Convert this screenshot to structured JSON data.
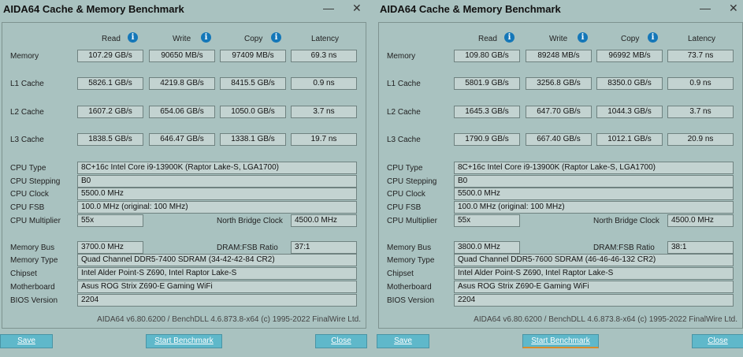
{
  "windows": [
    {
      "title": "AIDA64 Cache & Memory Benchmark",
      "minimize_glyph": "—",
      "close_glyph": "✕",
      "headers": {
        "read": "Read",
        "write": "Write",
        "copy": "Copy",
        "latency": "Latency",
        "info_glyph": "i"
      },
      "rows": [
        {
          "label": "Memory",
          "read": "107.29 GB/s",
          "write": "90650 MB/s",
          "copy": "97409 MB/s",
          "latency": "69.3 ns"
        },
        {
          "label": "L1 Cache",
          "read": "5826.1 GB/s",
          "write": "4219.8 GB/s",
          "copy": "8415.5 GB/s",
          "latency": "0.9 ns"
        },
        {
          "label": "L2 Cache",
          "read": "1607.2 GB/s",
          "write": "654.06 GB/s",
          "copy": "1050.0 GB/s",
          "latency": "3.7 ns"
        },
        {
          "label": "L3 Cache",
          "read": "1838.5 GB/s",
          "write": "646.47 GB/s",
          "copy": "1338.1 GB/s",
          "latency": "19.7 ns"
        }
      ],
      "cpu": {
        "type_label": "CPU Type",
        "type": "8C+16c Intel Core i9-13900K  (Raptor Lake-S, LGA1700)",
        "stepping_label": "CPU Stepping",
        "stepping": "B0",
        "clock_label": "CPU Clock",
        "clock": "5500.0 MHz",
        "fsb_label": "CPU FSB",
        "fsb": "100.0 MHz  (original: 100 MHz)",
        "mult_label": "CPU Multiplier",
        "mult": "55x",
        "nb_label": "North Bridge Clock",
        "nb": "4500.0 MHz"
      },
      "mem": {
        "bus_label": "Memory Bus",
        "bus": "3700.0 MHz",
        "ratio_label": "DRAM:FSB Ratio",
        "ratio": "37:1",
        "type_label": "Memory Type",
        "type": "Quad Channel DDR5-7400 SDRAM  (34-42-42-84 CR2)",
        "chipset_label": "Chipset",
        "chipset": "Intel Alder Point-S Z690, Intel Raptor Lake-S",
        "mobo_label": "Motherboard",
        "mobo": "Asus ROG Strix Z690-E Gaming WiFi",
        "bios_label": "BIOS Version",
        "bios": "2204"
      },
      "footer": "AIDA64 v6.80.6200 / BenchDLL 4.6.873.8-x64  (c) 1995-2022 FinalWire Ltd.",
      "buttons": {
        "save": "Save",
        "start": "Start Benchmark",
        "close": "Close"
      }
    },
    {
      "title": "AIDA64 Cache & Memory Benchmark",
      "minimize_glyph": "—",
      "close_glyph": "✕",
      "headers": {
        "read": "Read",
        "write": "Write",
        "copy": "Copy",
        "latency": "Latency",
        "info_glyph": "i"
      },
      "rows": [
        {
          "label": "Memory",
          "read": "109.80 GB/s",
          "write": "89248 MB/s",
          "copy": "96992 MB/s",
          "latency": "73.7 ns"
        },
        {
          "label": "L1 Cache",
          "read": "5801.9 GB/s",
          "write": "3256.8 GB/s",
          "copy": "8350.0 GB/s",
          "latency": "0.9 ns"
        },
        {
          "label": "L2 Cache",
          "read": "1645.3 GB/s",
          "write": "647.70 GB/s",
          "copy": "1044.3 GB/s",
          "latency": "3.7 ns"
        },
        {
          "label": "L3 Cache",
          "read": "1790.9 GB/s",
          "write": "667.40 GB/s",
          "copy": "1012.1 GB/s",
          "latency": "20.9 ns"
        }
      ],
      "cpu": {
        "type_label": "CPU Type",
        "type": "8C+16c Intel Core i9-13900K  (Raptor Lake-S, LGA1700)",
        "stepping_label": "CPU Stepping",
        "stepping": "B0",
        "clock_label": "CPU Clock",
        "clock": "5500.0 MHz",
        "fsb_label": "CPU FSB",
        "fsb": "100.0 MHz  (original: 100 MHz)",
        "mult_label": "CPU Multiplier",
        "mult": "55x",
        "nb_label": "North Bridge Clock",
        "nb": "4500.0 MHz"
      },
      "mem": {
        "bus_label": "Memory Bus",
        "bus": "3800.0 MHz",
        "ratio_label": "DRAM:FSB Ratio",
        "ratio": "38:1",
        "type_label": "Memory Type",
        "type": "Quad Channel DDR5-7600 SDRAM  (46-46-46-132 CR2)",
        "chipset_label": "Chipset",
        "chipset": "Intel Alder Point-S Z690, Intel Raptor Lake-S",
        "mobo_label": "Motherboard",
        "mobo": "Asus ROG Strix Z690-E Gaming WiFi",
        "bios_label": "BIOS Version",
        "bios": "2204"
      },
      "footer": "AIDA64 v6.80.6200 / BenchDLL 4.6.873.8-x64  (c) 1995-2022 FinalWire Ltd.",
      "buttons": {
        "save": "Save",
        "start": "Start Benchmark",
        "close": "Close"
      }
    }
  ]
}
